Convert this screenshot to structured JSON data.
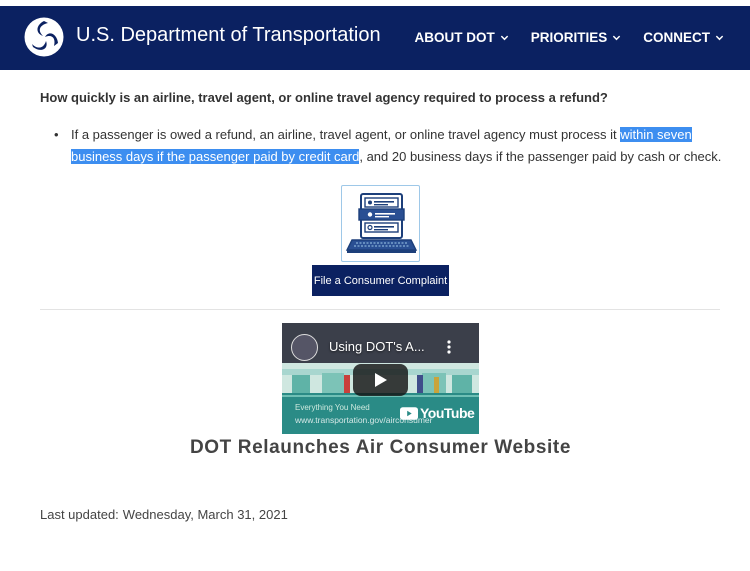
{
  "header": {
    "site_title": "U.S. Department of Transportation",
    "nav": [
      {
        "label": "ABOUT DOT"
      },
      {
        "label": "PRIORITIES"
      },
      {
        "label": "CONNECT"
      }
    ],
    "background_color": "#0b2161"
  },
  "content": {
    "question": "How quickly is an airline, travel agent, or online travel agency required to process a refund?",
    "answer": {
      "before_highlight": "If a passenger is owed a refund, an airline, travel agent, or online travel agency must process it ",
      "highlight": "within seven business days if the passenger paid by credit card",
      "after_highlight": ", and 20 business days if the passenger paid by cash or check.",
      "highlight_color": "#3d8ef0"
    },
    "complaint": {
      "icon": "laptop-form-icon",
      "button_label": "File a Consumer Complaint"
    },
    "video": {
      "title": "Using DOT's A...",
      "caption": "Everything You Need",
      "url_caption": "www.transportation.gov/airconsumer",
      "platform": "YouTube",
      "heading": "DOT Relaunches Air Consumer Website"
    },
    "last_updated": {
      "label": "Last updated:",
      "date": "Wednesday, March 31, 2021"
    }
  }
}
